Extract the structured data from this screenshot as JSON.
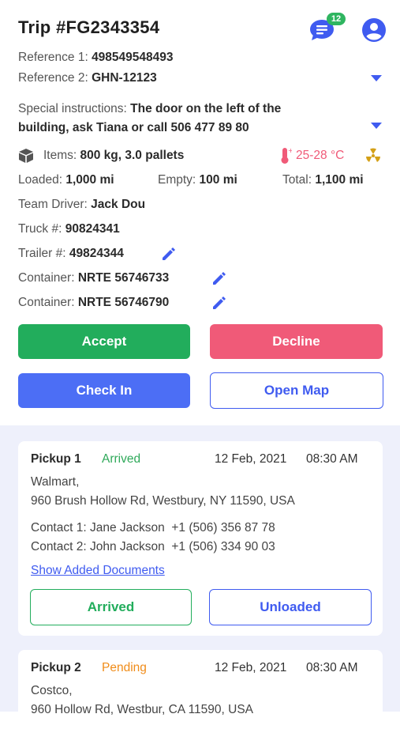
{
  "header": {
    "title": "Trip #FG2343354",
    "chat_badge": "12",
    "icons": {
      "chat": "chat-bubble-icon",
      "profile": "account-circle-icon"
    }
  },
  "details": {
    "reference1_label": "Reference 1:",
    "reference1_value": "498549548493",
    "reference2_label": "Reference 2:",
    "reference2_value": "GHN-12123",
    "special_label": "Special instructions:",
    "special_value_line1": "The door on the left of the",
    "special_value_line2": "building, ask Tiana or call 506 477 89 80",
    "items_label": "Items:",
    "items_value": "800 kg, 3.0 pallets",
    "temperature": "25-28 °C",
    "loaded_label": "Loaded:",
    "loaded_value": "1,000 mi",
    "empty_label": "Empty:",
    "empty_value": "100 mi",
    "total_label": "Total:",
    "total_value": "1,100 mi",
    "team_driver_label": "Team Driver:",
    "team_driver_value": "Jack Dou",
    "truck_label": "Truck #:",
    "truck_value": "90824341",
    "trailer_label": "Trailer #:",
    "trailer_value": "49824344",
    "container1_label": "Container:",
    "container1_value": "NRTE 56746733",
    "container2_label": "Container:",
    "container2_value": "NRTE 56746790"
  },
  "actions": {
    "accept": "Accept",
    "decline": "Decline",
    "check_in": "Check In",
    "open_map": "Open Map",
    "colors": {
      "accept": "#22ad5c",
      "decline": "#f05a78",
      "check_in": "#4c6ef5",
      "outline": "#3f5bf0"
    }
  },
  "stops": [
    {
      "title": "Pickup 1",
      "status": "Arrived",
      "date": "12 Feb, 2021",
      "time": "08:30 AM",
      "company": "Walmart,",
      "address": "960 Brush Hollow Rd, Westbury, NY 11590, USA",
      "contact1_label": "Contact 1: Jane Jackson",
      "contact1_phone": "+1 (506) 356 87 78",
      "contact2_label": "Contact 2: John Jackson",
      "contact2_phone": "+1 (506) 334 90 03",
      "docs_link": "Show Added Documents",
      "btn_arrived": "Arrived",
      "btn_unloaded": "Unloaded"
    },
    {
      "title": "Pickup 2",
      "status": "Pending",
      "date": "12 Feb, 2021",
      "time": "08:30 AM",
      "company": "Costco,",
      "address": "960 Hollow Rd, Westbur, CA 11590, USA"
    }
  ]
}
